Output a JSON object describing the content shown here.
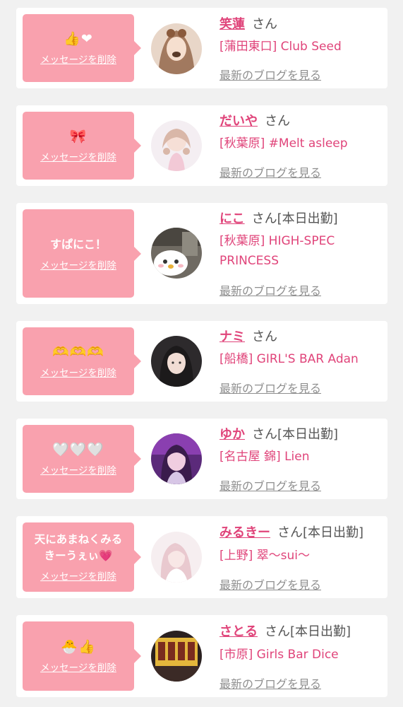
{
  "cards": [
    {
      "message": "👍❤",
      "delete": "メッセージを削除",
      "name": "笑蓮",
      "san": "さん",
      "today": "",
      "shop": "[蒲田東口] Club Seed",
      "blog": "最新のブログを見る"
    },
    {
      "message": "🎀",
      "delete": "メッセージを削除",
      "name": "だいや",
      "san": "さん",
      "today": "",
      "shop": "[秋葉原] #Melt asleep",
      "blog": "最新のブログを見る"
    },
    {
      "message": "すぱにこ！",
      "delete": "メッセージを削除",
      "name": "にこ",
      "san": "さん",
      "today": "[本日出勤]",
      "shop": "[秋葉原] HIGH-SPEC PRINCESS",
      "blog": "最新のブログを見る"
    },
    {
      "message": "🫶🫶🫶",
      "delete": "メッセージを削除",
      "name": "ナミ",
      "san": "さん",
      "today": "",
      "shop": "[船橋] GIRL'S BAR Adan",
      "blog": "最新のブログを見る"
    },
    {
      "message": "🤍🤍🤍",
      "delete": "メッセージを削除",
      "name": "ゆか",
      "san": "さん",
      "today": "[本日出勤]",
      "shop": "[名古屋 錦] Lien",
      "blog": "最新のブログを見る"
    },
    {
      "message": "天にあまねくみるきーうぇぃ💗",
      "delete": "メッセージを削除",
      "name": "みるきー",
      "san": "さん",
      "today": "[本日出勤]",
      "shop": "[上野] 翠〜sui〜",
      "blog": "最新のブログを見る"
    },
    {
      "message": "🐣👍",
      "delete": "メッセージを削除",
      "name": "さとる",
      "san": "さん",
      "today": "[本日出勤]",
      "shop": "[市原] Girls Bar Dice",
      "blog": "最新のブログを見る"
    }
  ],
  "colors": {
    "bubble": "#f9a1ae",
    "name": "#e0447a",
    "shop": "#e0447a",
    "blog": "#8f8f8f"
  },
  "icons": [
    "avatar-photo"
  ]
}
